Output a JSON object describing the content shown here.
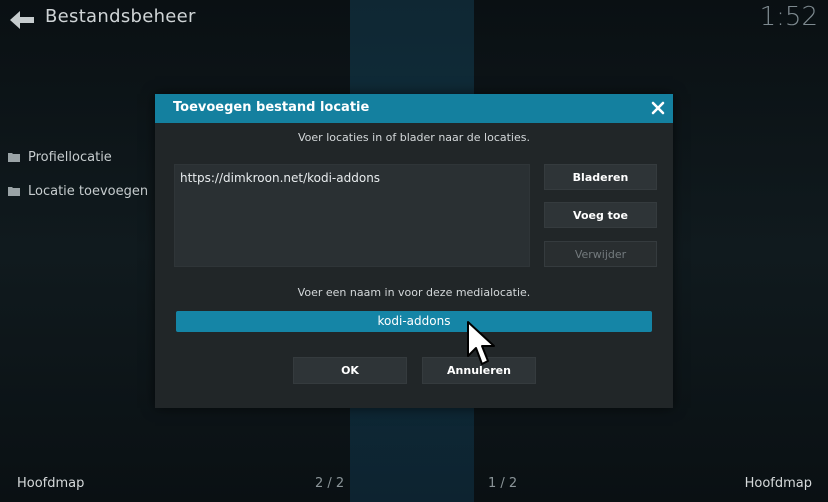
{
  "app": {
    "title": "Bestandsbeheer",
    "clock": "1:52"
  },
  "sidebar": {
    "items": [
      {
        "label": "Profiellocatie",
        "icon": "folder-icon"
      },
      {
        "label": "Locatie toevoegen",
        "icon": "folder-icon"
      }
    ]
  },
  "footer": {
    "left_label": "Hoofdmap",
    "right_label": "Hoofdmap",
    "page_left": "2 / 2",
    "page_right": "1 / 2"
  },
  "dialog": {
    "title": "Toevoegen bestand locatie",
    "instruction_locations": "Voer locaties in of blader naar de locaties.",
    "locations": [
      "https://dimkroon.net/kodi-addons"
    ],
    "browse_label": "Bladeren",
    "add_label": "Voeg toe",
    "remove_label": "Verwijder",
    "instruction_name": "Voer een naam in voor deze medialocatie.",
    "name_value": "kodi-addons",
    "ok_label": "OK",
    "cancel_label": "Annuleren"
  },
  "colors": {
    "accent": "#14809f",
    "dialog_bg": "#212628",
    "button_bg": "#2e3437"
  },
  "icons": {
    "back": "back-arrow-icon",
    "close": "close-icon",
    "folder": "folder-icon",
    "cursor": "mouse-pointer-icon"
  }
}
